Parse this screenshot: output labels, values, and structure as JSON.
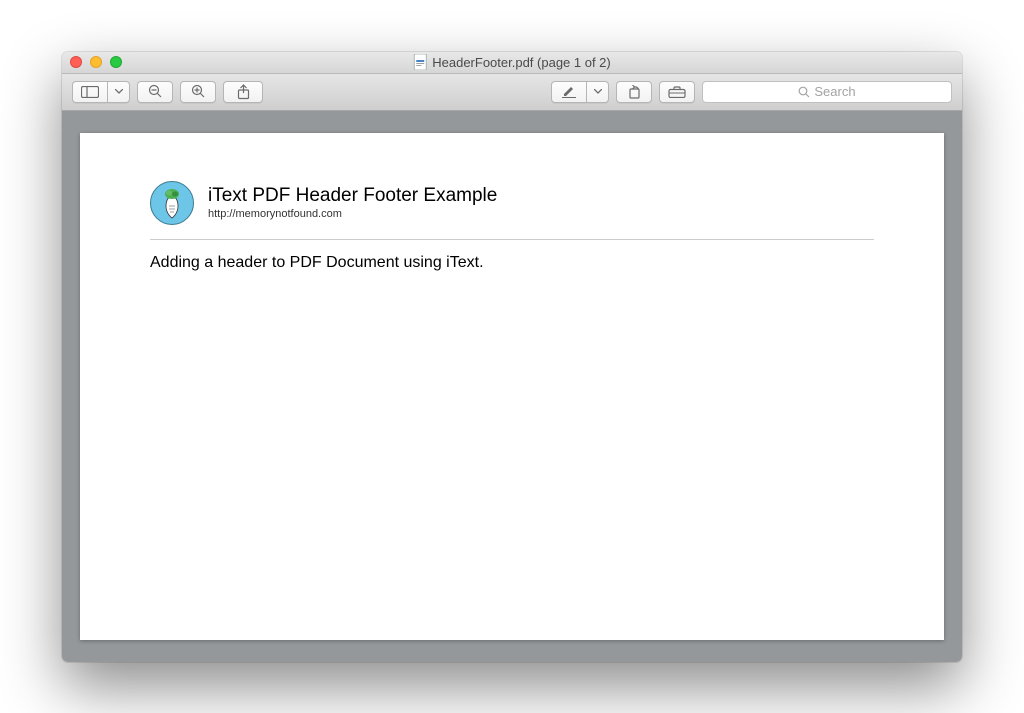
{
  "window": {
    "title": "HeaderFooter.pdf (page 1 of 2)"
  },
  "toolbar": {
    "search_placeholder": "Search"
  },
  "document": {
    "header_title": "iText PDF Header Footer Example",
    "header_subtitle": "http://memorynotfound.com",
    "body_text": "Adding a header to PDF Document using iText."
  }
}
